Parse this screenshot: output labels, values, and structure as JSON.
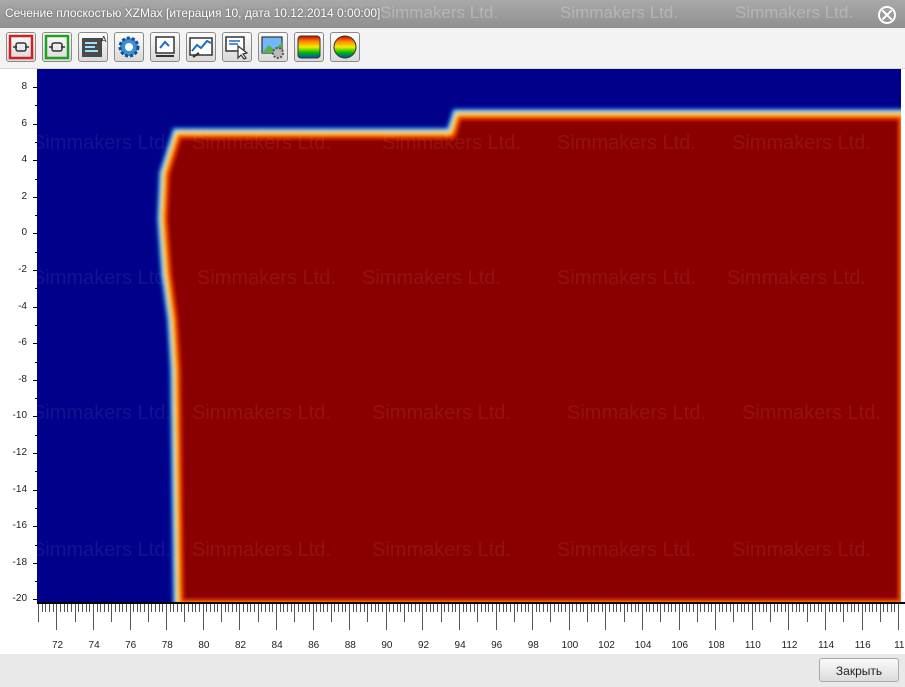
{
  "window": {
    "title": "Сечение плоскостью XZMax [итерация 10, дата 10.12.2014 0:00:00]",
    "watermark": "Simmakers Ltd."
  },
  "toolbar": {
    "buttons": [
      {
        "name": "fit-view-button",
        "icon": "frame-red-icon"
      },
      {
        "name": "fit-width-button",
        "icon": "frame-green-icon"
      },
      {
        "name": "legend-button",
        "icon": "legend-icon"
      },
      {
        "name": "settings-button",
        "icon": "gear-icon"
      },
      {
        "name": "probe-button",
        "icon": "probe-icon"
      },
      {
        "name": "graph-button",
        "icon": "chart-icon"
      },
      {
        "name": "select-point-button",
        "icon": "pointer-icon"
      },
      {
        "name": "export-settings-button",
        "icon": "image-gear-icon"
      },
      {
        "name": "color-scale-button",
        "icon": "palette-square-icon"
      },
      {
        "name": "color-scale-round-button",
        "icon": "palette-circle-icon"
      }
    ]
  },
  "plot": {
    "colors": {
      "background": "#00008a",
      "body": "#8a0000"
    },
    "y_ticks": [
      "8",
      "6",
      "4",
      "2",
      "0",
      "-2",
      "-4",
      "-6",
      "-8",
      "-10",
      "-12",
      "-14",
      "-16",
      "-18",
      "-20"
    ],
    "x_ticks": [
      "72",
      "74",
      "76",
      "78",
      "80",
      "82",
      "84",
      "86",
      "88",
      "90",
      "92",
      "94",
      "96",
      "98",
      "100",
      "102",
      "104",
      "106",
      "108",
      "110",
      "112",
      "114",
      "116",
      "11"
    ]
  },
  "footer": {
    "close_label": "Закрыть"
  }
}
